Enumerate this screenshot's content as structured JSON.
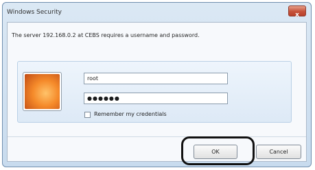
{
  "dialog": {
    "title": "Windows Security",
    "close_symbol": "x",
    "message": "The server 192.168.0.2 at CEBS requires a username and password.",
    "username": {
      "value": "root"
    },
    "password": {
      "value": "●●●●●●"
    },
    "remember_label": "Remember my credentials",
    "ok_label": "OK",
    "cancel_label": "Cancel"
  },
  "icons": {
    "user_tile": "user-picture-icon",
    "close": "close-icon"
  },
  "colors": {
    "close_button": "#c5523a",
    "highlight_outline": "#111111"
  }
}
